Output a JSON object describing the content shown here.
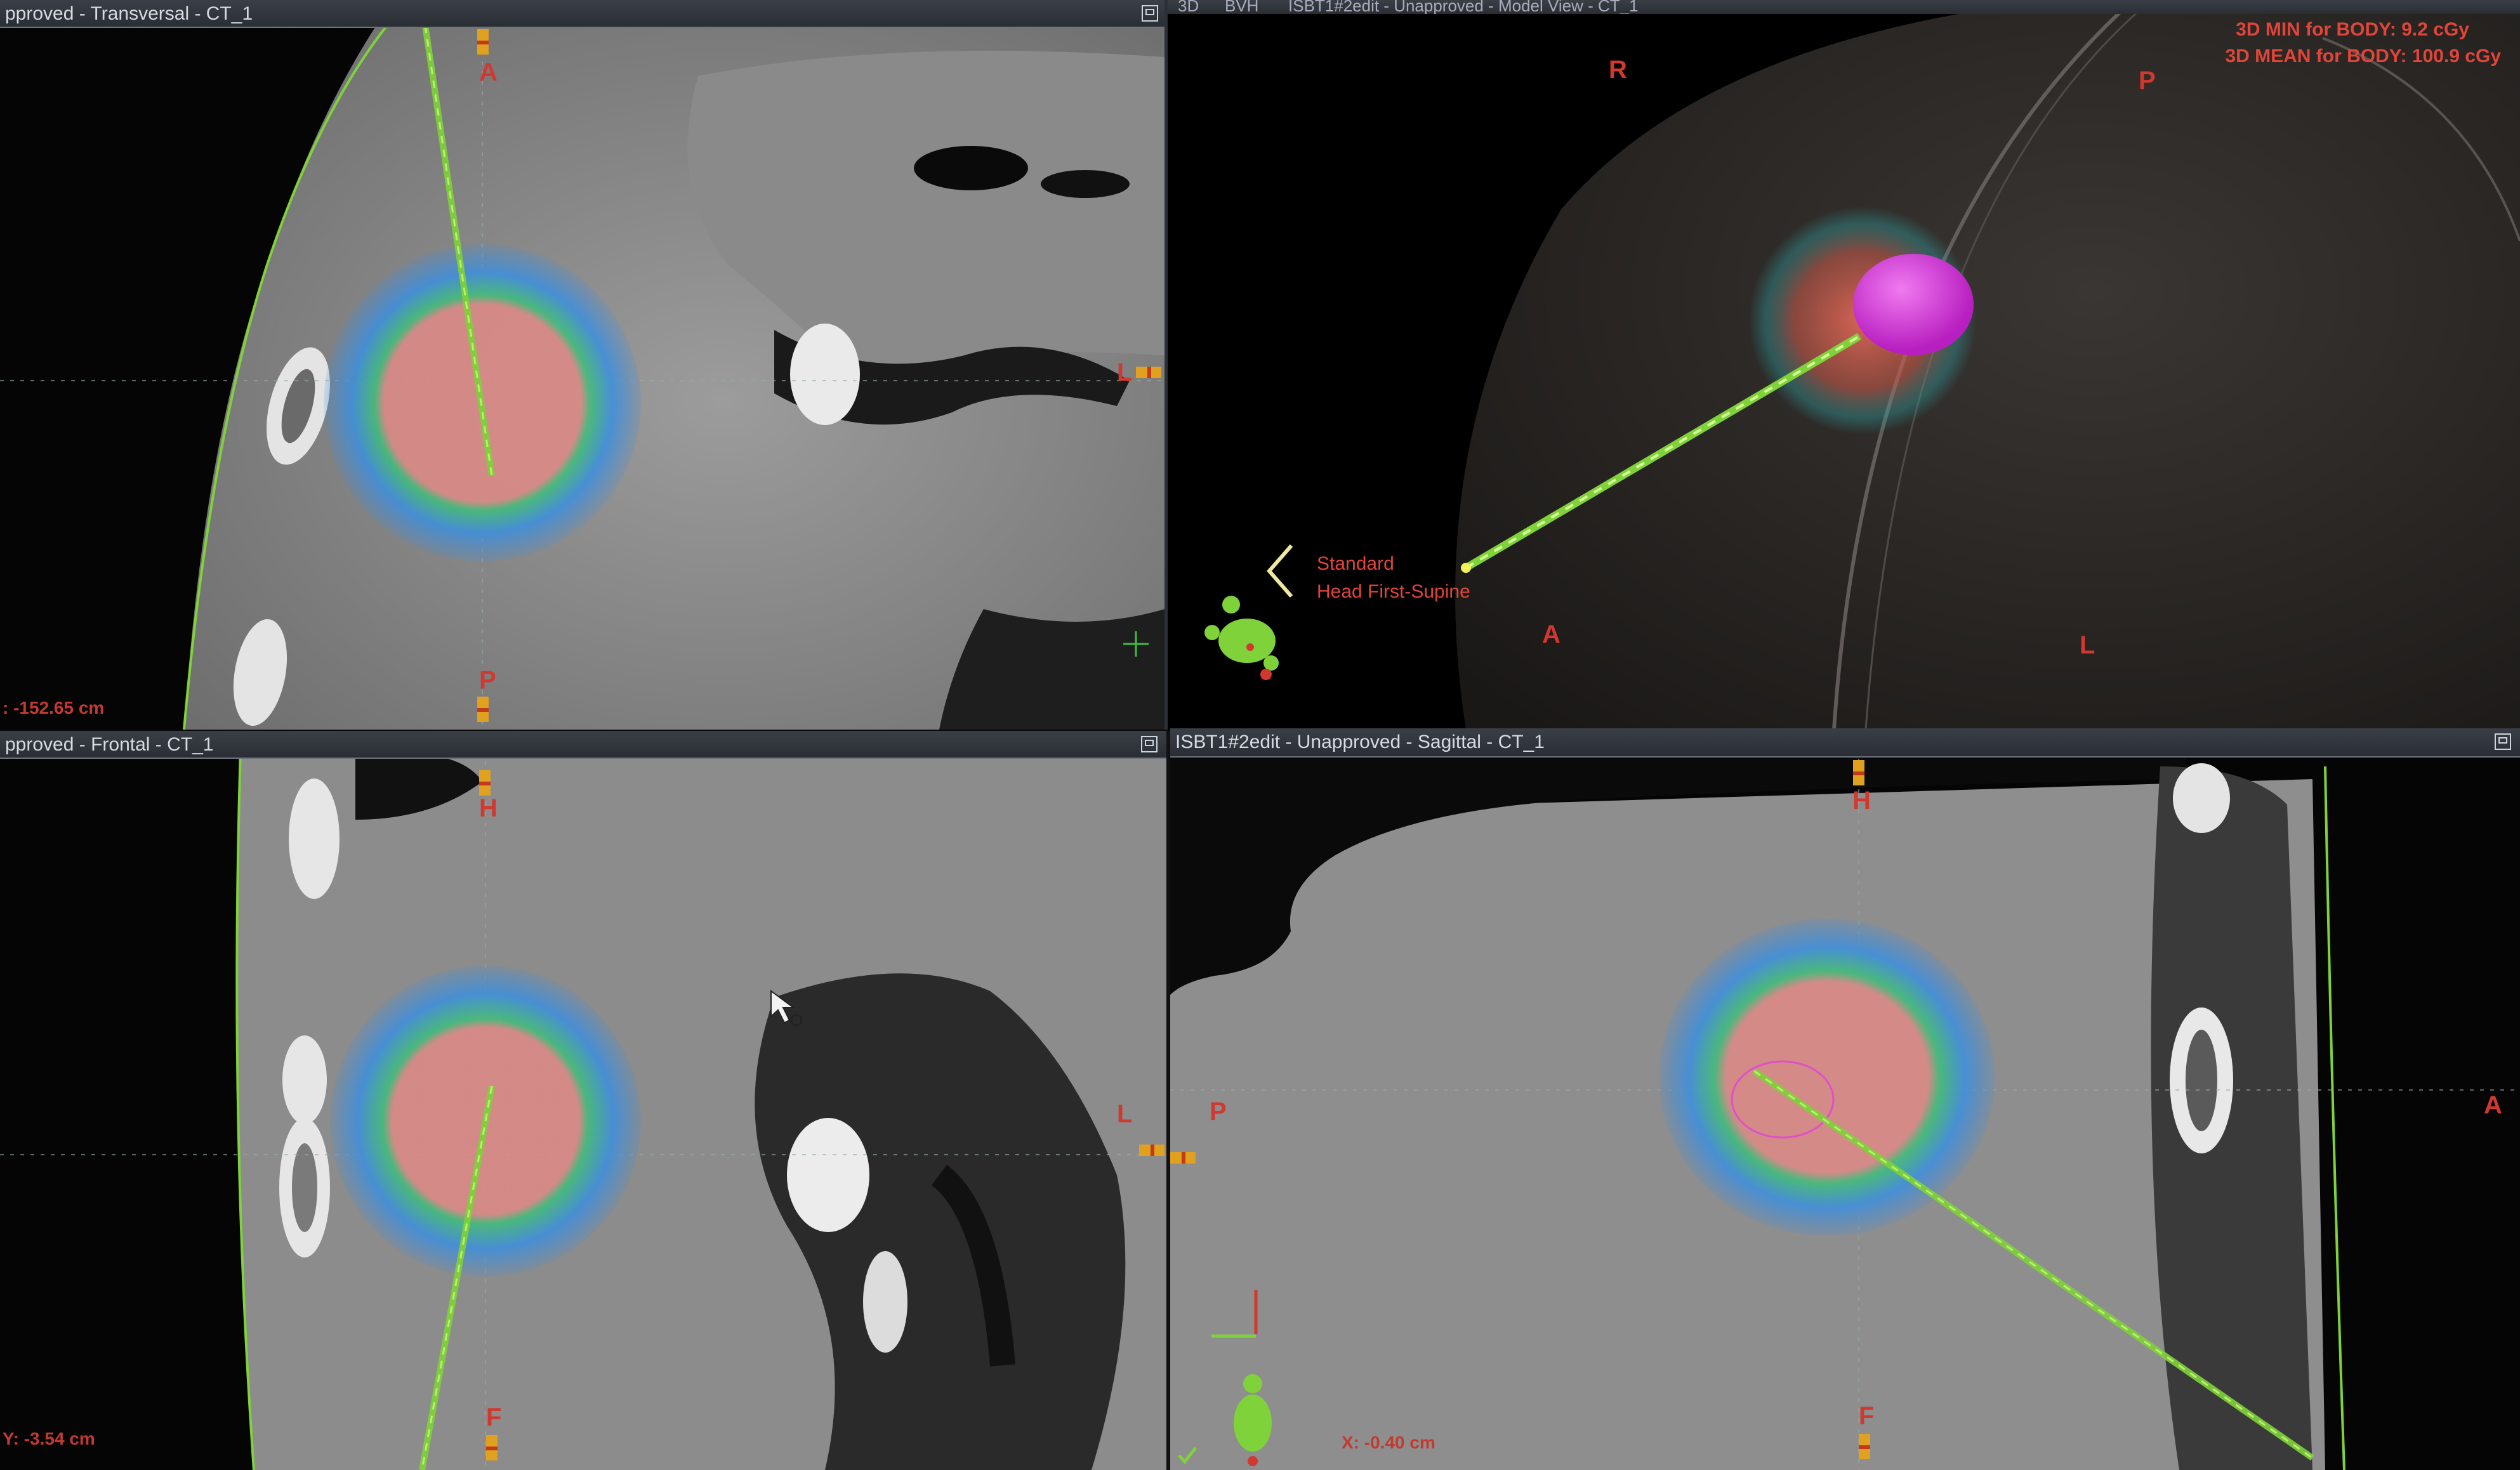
{
  "panes": {
    "transversal": {
      "title": "pproved - Transversal - CT_1",
      "orient_top": "A",
      "orient_bottom": "P",
      "orient_right": "L",
      "readout": ": -152.65 cm"
    },
    "view3d": {
      "tabs": [
        "3D",
        "BVH",
        "ISBT1#2edit - Unapproved - Model View - CT_1"
      ],
      "stats_line1": "3D MIN for BODY: 9.2 cGy",
      "stats_line2": "3D MEAN for BODY: 100.9 cGy",
      "orient_r": "R",
      "orient_p": "P",
      "orient_a": "A",
      "orient_l": "L",
      "patient_pos_line1": "Standard",
      "patient_pos_line2": "Head First-Supine"
    },
    "frontal": {
      "title": "pproved - Frontal - CT_1",
      "orient_top": "H",
      "orient_bottom": "F",
      "orient_right": "L",
      "readout": "Y: -3.54 cm"
    },
    "sagittal": {
      "title": "ISBT1#2edit  -  Unapproved - Sagittal - CT_1",
      "orient_top": "H",
      "orient_bottom": "F",
      "orient_left": "P",
      "orient_right": "A",
      "readout": "X: -0.40 cm"
    }
  },
  "icons": [
    "maximize-icon",
    "cursor-icon",
    "patient-orientation-icon",
    "crosshair-icon",
    "check-icon"
  ],
  "colors": {
    "dose_core": "#e08a86",
    "dose_mid": "#2ebf7a",
    "dose_outer": "#3b8fe0",
    "catheter": "#7fd23a",
    "target_3d": "#d43cd8",
    "label_red": "#d1382f"
  }
}
